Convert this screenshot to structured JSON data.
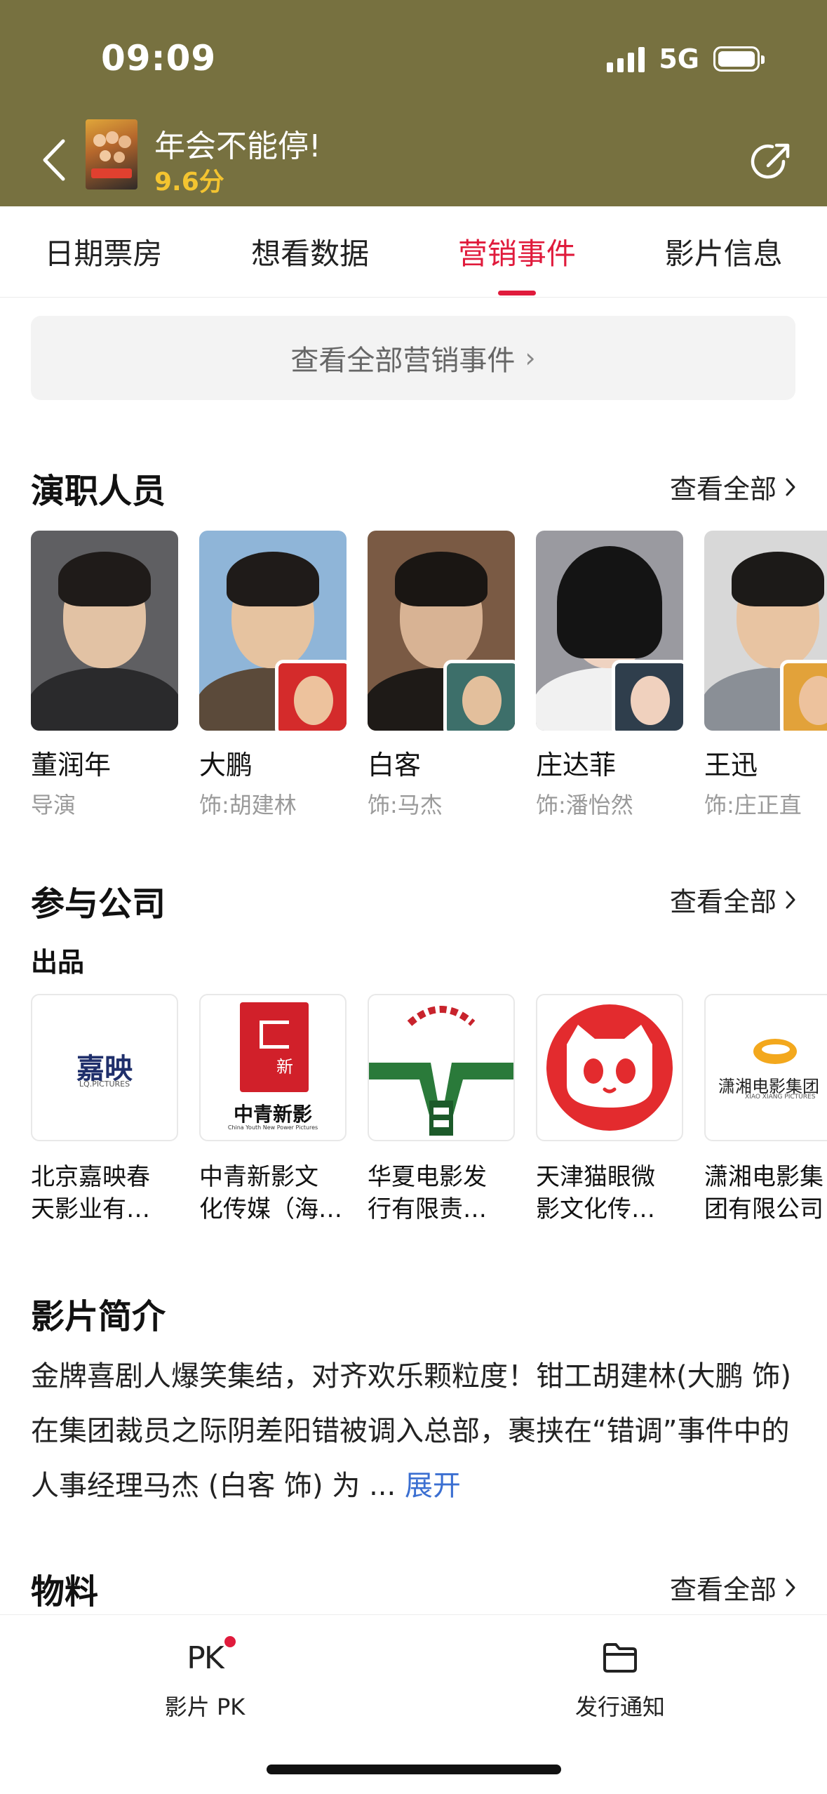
{
  "status_bar": {
    "time": "09:09",
    "network": "5G"
  },
  "header": {
    "movie_title": "年会不能停!",
    "score": "9.6分",
    "back_icon": "chevron-left-icon",
    "share_icon": "share-icon",
    "bg_color": "#777140"
  },
  "tabs": [
    {
      "label": "日期票房",
      "active": false
    },
    {
      "label": "想看数据",
      "active": false
    },
    {
      "label": "营销事件",
      "active": true
    },
    {
      "label": "影片信息",
      "active": false
    }
  ],
  "marketing": {
    "label": "查看全部营销事件",
    "chevron": "›"
  },
  "cast_section": {
    "title": "演职人员",
    "see_all": "查看全部",
    "items": [
      {
        "name": "董润年",
        "role": "导演"
      },
      {
        "name": "大鹏",
        "role": "饰:胡建林"
      },
      {
        "name": "白客",
        "role": "饰:马杰"
      },
      {
        "name": "庄达菲",
        "role": "饰:潘怡然"
      },
      {
        "name": "王迅",
        "role": "饰:庄正直"
      }
    ]
  },
  "company_section": {
    "title": "参与公司",
    "see_all": "查看全部",
    "subtitle": "出品",
    "items": [
      {
        "line1": "北京嘉映春",
        "line2": "天影业有…",
        "logo_text": "嘉映",
        "logo_sub": "LQ.PICTURES"
      },
      {
        "line1": "中青新影文",
        "line2": "化传媒（海…",
        "logo_text": "中青新影",
        "logo_sub": "China Youth New Power Pictures"
      },
      {
        "line1": "华夏电影发",
        "line2": "行有限责…"
      },
      {
        "line1": "天津猫眼微",
        "line2": "影文化传…"
      },
      {
        "line1": "潇湘电影集",
        "line2": "团有限公司",
        "logo_text": "潇湘电影集团",
        "logo_sub": "XIAO XIANG PICTURES"
      }
    ]
  },
  "synopsis": {
    "title": "影片简介",
    "text": "金牌喜剧人爆笑集结，对齐欢乐颗粒度！钳工胡建林(大鹏 饰)在集团裁员之际阴差阳错被调入总部，裹挟在“错调”事件中的人事经理马杰 (白客 饰) 为 ...",
    "expand": "展开"
  },
  "materials": {
    "title": "物料",
    "see_all": "查看全部"
  },
  "bottom_bar": [
    {
      "icon_text": "PK",
      "label": "影片 PK",
      "icon": "pk-icon",
      "has_badge": true
    },
    {
      "label": "发行通知",
      "icon": "folder-icon"
    }
  ],
  "colors": {
    "accent": "#e01b3c",
    "score": "#f4c430",
    "link": "#3b6fd1"
  }
}
